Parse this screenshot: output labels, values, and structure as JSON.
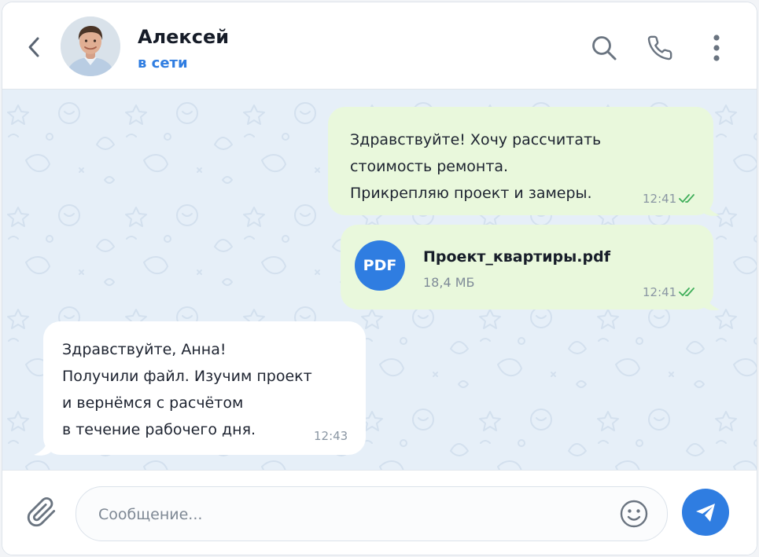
{
  "header": {
    "contact_name": "Алексей",
    "status": "в сети",
    "icons": {
      "back": "chevron-left-icon",
      "search": "search-icon",
      "call": "phone-icon",
      "menu": "more-vertical-icon"
    }
  },
  "messages": [
    {
      "direction": "outgoing",
      "lines": [
        "Здравствуйте! Хочу рассчитать",
        "стоимость ремонта.",
        "Прикрепляю проект и замеры."
      ],
      "time": "12:41",
      "read": true
    },
    {
      "direction": "outgoing",
      "type": "file",
      "file_icon_label": "PDF",
      "file_name": "Проект_квартиры.pdf",
      "file_size": "18,4 МБ",
      "time": "12:41",
      "read": true
    },
    {
      "direction": "incoming",
      "lines": [
        "Здравствуйте, Анна!",
        "Получили файл. Изучим проект",
        "и вернёмся с расчётом",
        "в течение рабочего дня."
      ],
      "time": "12:43"
    }
  ],
  "composer": {
    "placeholder": "Сообщение...",
    "icons": {
      "attach": "paperclip-icon",
      "emoji": "emoji-icon",
      "send": "send-icon"
    }
  },
  "colors": {
    "accent": "#2f7de1",
    "outgoing_bubble": "#e9f8dc",
    "incoming_bubble": "#ffffff",
    "chat_background": "#e6eff8",
    "read_ticks": "#3fae5a"
  }
}
